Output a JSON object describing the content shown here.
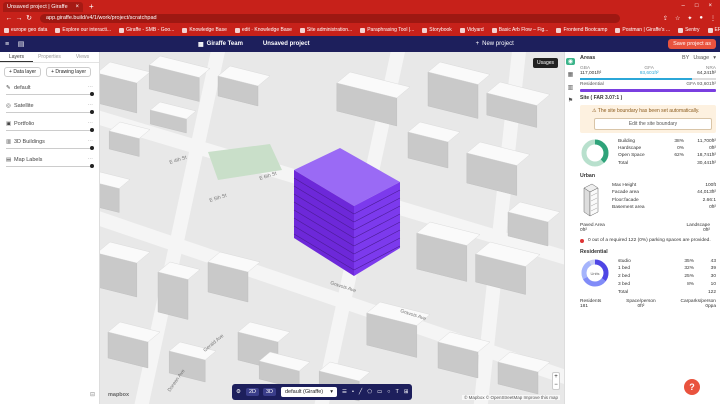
{
  "browser": {
    "tab_title": "Unsaved project | Giraffe",
    "url": "app.giraffe.build/v4/1/work/project/scratchpad",
    "bookmarks": [
      "europe geo data",
      "Explore our interacti...",
      "Giraffe - SMB - Goo...",
      "Knowledge Base",
      "edit · Knowledge Base",
      "Site administration...",
      "Paraphrasing Tool |...",
      "Storybook",
      "Vidyard",
      "Basic Arb Flow – Fig...",
      "Frontend Bootcamp",
      "Postman | Giraffe's ...",
      "Sentry",
      "ER"
    ]
  },
  "app": {
    "team": "Giraffe Team",
    "project": "Unsaved project",
    "new_project": "New project",
    "save_project": "Save project as"
  },
  "left_panel": {
    "tabs": [
      "Layers",
      "Properties",
      "Views"
    ],
    "data_layer": "Data layer",
    "drawing_layer": "Drawing layer",
    "layers": [
      {
        "name": "default",
        "icon": "pencil-icon"
      },
      {
        "name": "Satellite",
        "icon": "satellite-icon"
      },
      {
        "name": "Portfolio",
        "icon": "portfolio-icon"
      },
      {
        "name": "3D Buildings",
        "icon": "buildings-icon"
      },
      {
        "name": "Map Labels",
        "icon": "labels-icon"
      }
    ]
  },
  "map": {
    "usages_label": "Usages",
    "logo": "mapbox",
    "attribution": "© Mapbox © OpenStreetMap  Improve this map",
    "street_labels": [
      "E 4th St",
      "E 5th St",
      "E 6th St",
      "Gravois Ave",
      "Gravois Ave",
      "Doreen Ave",
      "Gerald Ave"
    ],
    "building_color": "#7c3aed"
  },
  "toolbar": {
    "view_2d": "2D",
    "view_3d": "3D",
    "layer_select": "default (Giraffe)"
  },
  "areas": {
    "title": "Areas",
    "by_label": "BY",
    "by_value": "Usage",
    "gba_label": "GBA",
    "gba_value": "117,001ft²",
    "gfa_label": "GFA",
    "gfa_value": "93,601ft²",
    "nra_label": "NRA",
    "nra_value": "64,241ft²",
    "gfa_fraction": 0.82,
    "residential_label": "Residential",
    "residential_value": "GFA 93,601ft²",
    "site_label": "Site ( FAR 3.07:1 )",
    "warning_text": "The site boundary has been set automatically.",
    "edit_boundary": "Edit the site boundary",
    "site_stats": [
      {
        "name": "Building",
        "pct": "38%",
        "value": "11,700ft²"
      },
      {
        "name": "Hardscape",
        "pct": "0%",
        "value": "0ft²"
      },
      {
        "name": "Open Space",
        "pct": "62%",
        "value": "18,741ft²"
      },
      {
        "name": "Total",
        "pct": "",
        "value": "30,441ft²"
      }
    ],
    "site_colors": {
      "building": "#2fa37a",
      "open_space": "#b8e0cd"
    }
  },
  "urban": {
    "title": "Urban",
    "stats": [
      {
        "name": "Max Height",
        "value": "100ft"
      },
      {
        "name": "Facade area",
        "value": "44,013ft²"
      },
      {
        "name": "Floor:facade",
        "value": "2.66:1"
      },
      {
        "name": "Basement area",
        "value": "0ft²"
      }
    ],
    "paved_label": "Paved Area",
    "paved_value": "0ft²",
    "landscape_label": "Landscape",
    "landscape_value": "0ft²",
    "parking_text": "0 out of a required 122 (0%) parking spaces are provided."
  },
  "residential": {
    "title": "Residential",
    "donut_label": "Units",
    "units": [
      {
        "name": "studio",
        "pct": "35%",
        "value": "43"
      },
      {
        "name": "1 bed",
        "pct": "32%",
        "value": "39"
      },
      {
        "name": "2 bed",
        "pct": "25%",
        "value": "30"
      },
      {
        "name": "3 bed",
        "pct": "8%",
        "value": "10"
      },
      {
        "name": "Total",
        "pct": "",
        "value": "122"
      }
    ],
    "residents_label": "Residents",
    "residents_value": "181",
    "space_label": "Space/person",
    "space_value": "0ft²",
    "carparks_label": "Carparks/person",
    "carparks_value": "0ppa"
  }
}
